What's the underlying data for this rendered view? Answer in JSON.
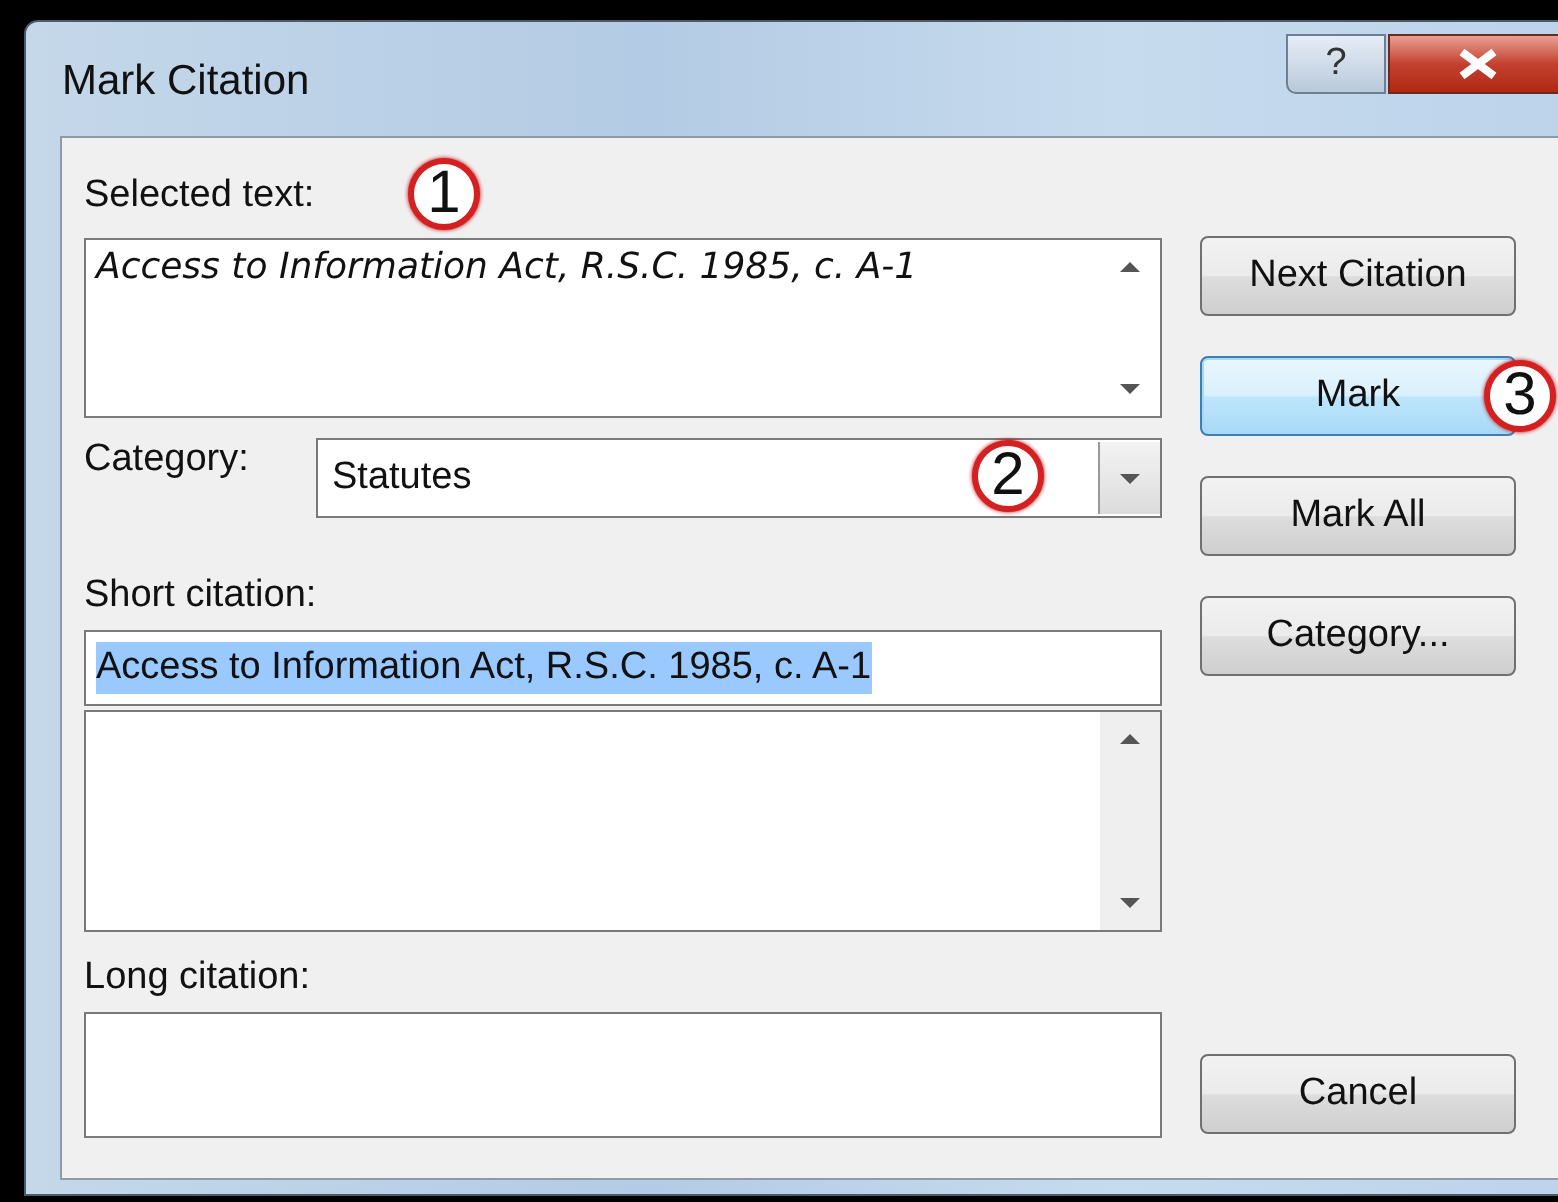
{
  "window": {
    "title": "Mark Citation",
    "help": "?"
  },
  "selected_text": {
    "label": "Selected text:",
    "value": "Access to Information Act, R.S.C. 1985, c. A-1"
  },
  "category": {
    "label": "Category:",
    "value": "Statutes"
  },
  "short_citation": {
    "label": "Short citation:",
    "value": "Access to Information Act, R.S.C. 1985, c. A-1",
    "selected": true
  },
  "long_citation": {
    "label": "Long citation:"
  },
  "buttons": [
    {
      "label": "Next Citation",
      "focused": false
    },
    {
      "label": "Mark",
      "focused": true
    },
    {
      "label": "Mark All",
      "focused": false
    },
    {
      "label": "Category...",
      "focused": false
    }
  ],
  "cancel": {
    "label": "Cancel"
  },
  "callouts": [
    "1",
    "2",
    "3"
  ]
}
